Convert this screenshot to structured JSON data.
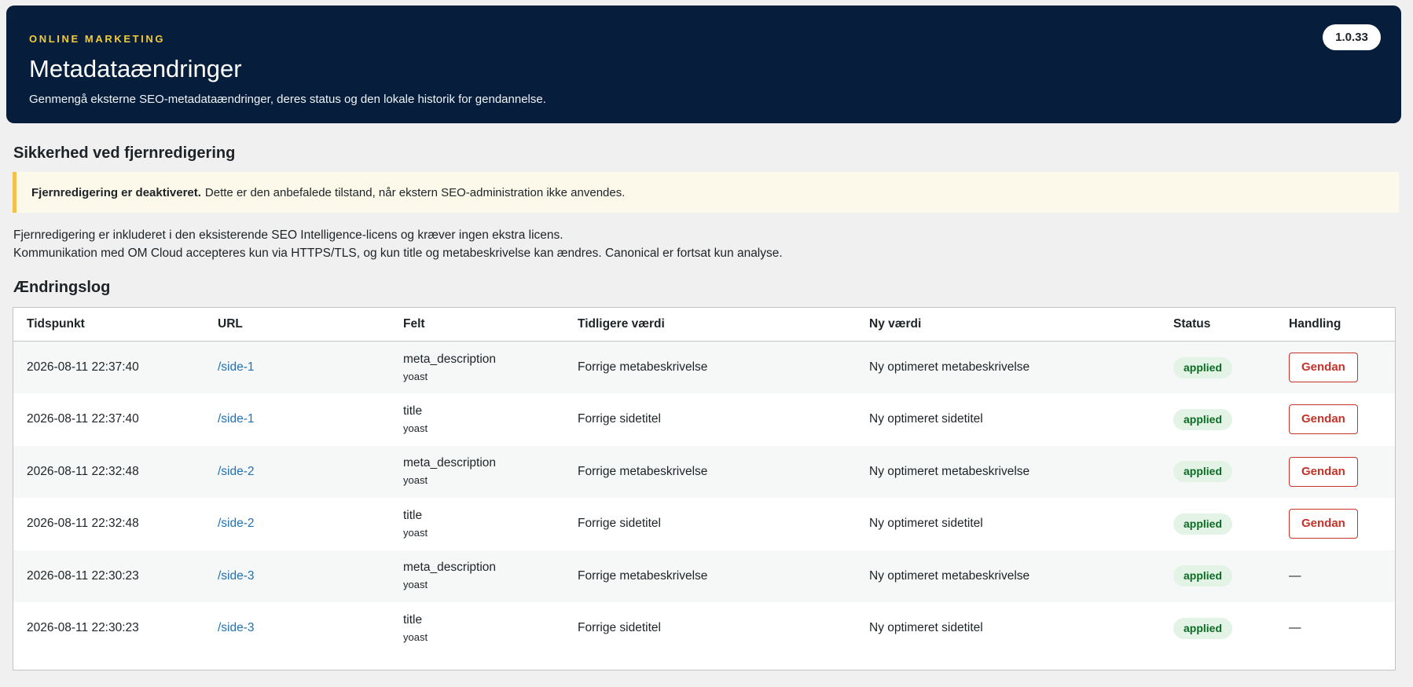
{
  "header": {
    "eyebrow": "ONLINE MARKETING",
    "title": "Metadataændringer",
    "subtitle": "Genmengå eksterne SEO-metadataændringer, deres status og den lokale historik for gendannelse.",
    "version": "1.0.33",
    "background_color": "#061e3b",
    "eyebrow_color": "#f2cb3b"
  },
  "remote_security": {
    "heading": "Sikkerhed ved fjernredigering",
    "notice_strong": "Fjernredigering er deaktiveret.",
    "notice_text": "Dette er den anbefalede tilstand, når ekstern SEO-administration ikke anvendes.",
    "info_line_1": "Fjernredigering er inkluderet i den eksisterende SEO Intelligence-licens og kræver ingen ekstra licens.",
    "info_line_2": "Kommunikation med OM Cloud accepteres kun via HTTPS/TLS, og kun title og metabeskrivelse kan ændres. Canonical er fortsat kun analyse."
  },
  "changelog": {
    "heading": "Ændringslog",
    "columns": {
      "time": "Tidspunkt",
      "url": "URL",
      "field": "Felt",
      "previous": "Tidligere værdi",
      "new": "Ny værdi",
      "status": "Status",
      "action": "Handling"
    },
    "rows": [
      {
        "time": "2026-08-11 22:37:40",
        "url": "/side-1",
        "field": "meta_description",
        "source": "yoast",
        "previous": "Forrige metabeskrivelse",
        "new": "Ny optimeret metabeskrivelse",
        "status": "applied",
        "action": "Gendan"
      },
      {
        "time": "2026-08-11 22:37:40",
        "url": "/side-1",
        "field": "title",
        "source": "yoast",
        "previous": "Forrige sidetitel",
        "new": "Ny optimeret sidetitel",
        "status": "applied",
        "action": "Gendan"
      },
      {
        "time": "2026-08-11 22:32:48",
        "url": "/side-2",
        "field": "meta_description",
        "source": "yoast",
        "previous": "Forrige metabeskrivelse",
        "new": "Ny optimeret metabeskrivelse",
        "status": "applied",
        "action": "Gendan"
      },
      {
        "time": "2026-08-11 22:32:48",
        "url": "/side-2",
        "field": "title",
        "source": "yoast",
        "previous": "Forrige sidetitel",
        "new": "Ny optimeret sidetitel",
        "status": "applied",
        "action": "Gendan"
      },
      {
        "time": "2026-08-11 22:30:23",
        "url": "/side-3",
        "field": "meta_description",
        "source": "yoast",
        "previous": "Forrige metabeskrivelse",
        "new": "Ny optimeret metabeskrivelse",
        "status": "applied",
        "action": "—"
      },
      {
        "time": "2026-08-11 22:30:23",
        "url": "/side-3",
        "field": "title",
        "source": "yoast",
        "previous": "Forrige sidetitel",
        "new": "Ny optimeret sidetitel",
        "status": "applied",
        "action": "—"
      }
    ]
  }
}
